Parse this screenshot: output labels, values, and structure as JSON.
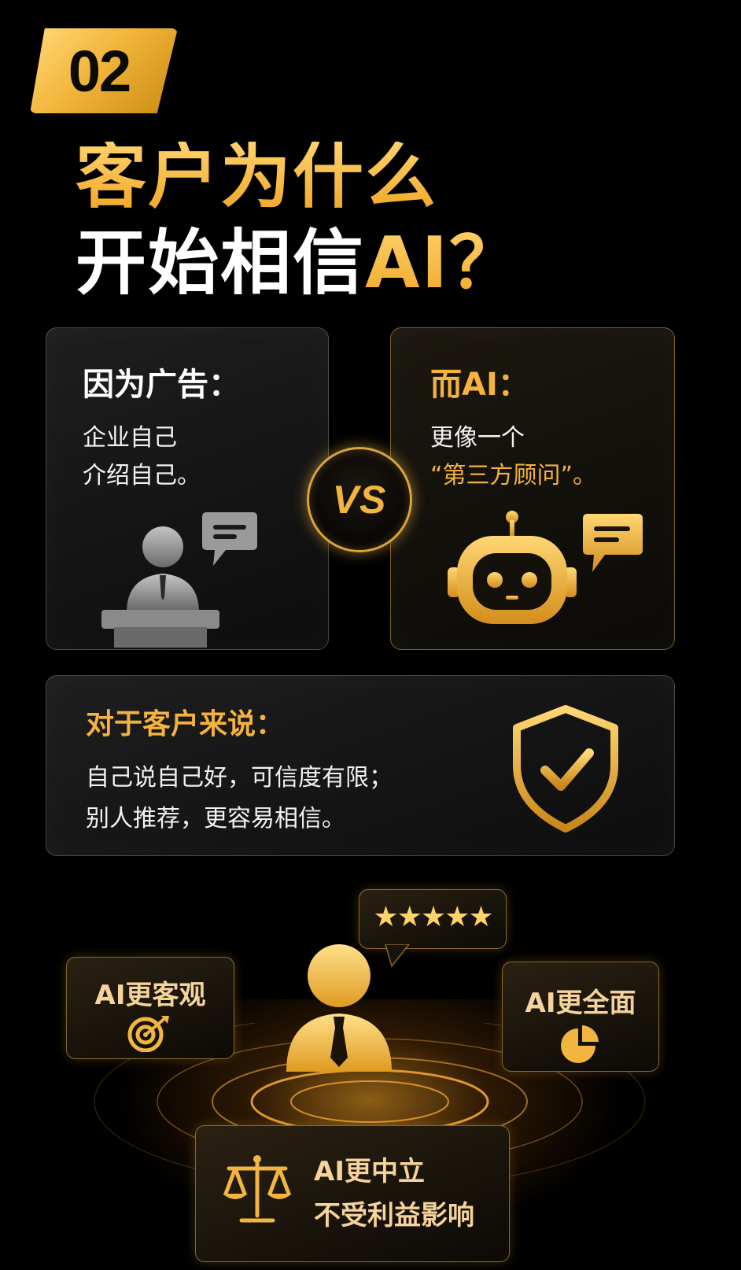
{
  "badge": {
    "number": "02"
  },
  "title": {
    "line1": "客户为什么",
    "line2_white": "开始相信",
    "line2_gold": "AI？"
  },
  "ad_card": {
    "heading": "因为广告：",
    "line1": "企业自己",
    "line2": "介绍自己。"
  },
  "vs_label": "VS",
  "ai_card": {
    "heading": "而AI：",
    "line1": "更像一个",
    "line2": "“第三方顾问”。"
  },
  "customer_card": {
    "heading": "对于客户来说：",
    "line1": "自己说自己好，可信度有限；",
    "line2": "别人推荐，更容易相信。"
  },
  "bottom": {
    "rating_stars": "★★★★★",
    "objective_tag": "AI更客观",
    "comprehensive_tag": "AI更全面",
    "neutral_tag_line1": "AI更中立",
    "neutral_tag_line2": "不受利益影响"
  },
  "colors": {
    "gold": "#f4b23e",
    "gold_light": "#ffd26b",
    "background": "#000000",
    "gray_icon": "#8a8a8a"
  },
  "icons": [
    "presenter-icon",
    "speech-bubble-icon",
    "robot-icon",
    "shield-check-icon",
    "person-icon",
    "target-icon",
    "pie-chart-icon",
    "scales-icon"
  ]
}
